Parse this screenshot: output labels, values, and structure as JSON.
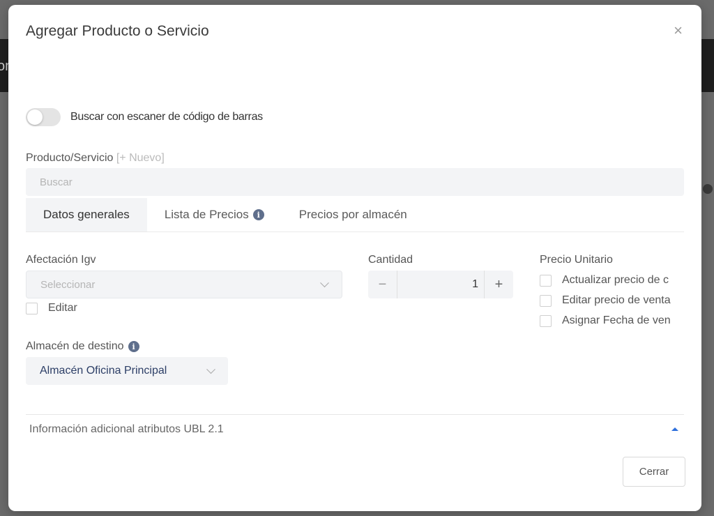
{
  "background": {
    "header_fragment": "on"
  },
  "modal": {
    "title": "Agregar Producto o Servicio",
    "close_glyph": "×"
  },
  "barcode": {
    "label": "Buscar con escaner de código de barras",
    "enabled": false
  },
  "product": {
    "label": "Producto/Servicio",
    "new_link": "[+ Nuevo]",
    "search_placeholder": "Buscar",
    "search_value": ""
  },
  "tabs": [
    {
      "label": "Datos generales",
      "active": true
    },
    {
      "label": "Lista de Precios",
      "icon": "info-icon"
    },
    {
      "label": "Precios por almacén"
    }
  ],
  "igv": {
    "label": "Afectación Igv",
    "placeholder": "Seleccionar",
    "edit_label": "Editar"
  },
  "quantity": {
    "label": "Cantidad",
    "value": "1",
    "minus": "−",
    "plus": "+"
  },
  "unit_price": {
    "label": "Precio Unitario",
    "options": [
      "Actualizar precio de c",
      "Editar precio de venta",
      "Asignar Fecha de ven"
    ]
  },
  "warehouse": {
    "label": "Almacén de destino",
    "selected": "Almacén Oficina Principal"
  },
  "accordion": {
    "label": "Información adicional atributos UBL 2.1"
  },
  "footer": {
    "close_label": "Cerrar"
  },
  "colors": {
    "accent": "#2d6fdc",
    "field_bg": "#f3f4f6",
    "selected_text": "#2c3e66"
  }
}
